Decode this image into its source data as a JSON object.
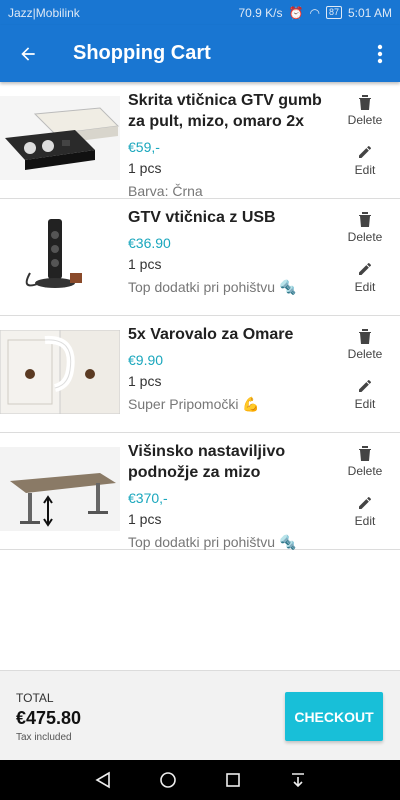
{
  "status": {
    "carrier": "Jazz|Mobilink",
    "speed": "70.9 K/s",
    "battery": "87",
    "time": "5:01 AM"
  },
  "appbar": {
    "title": "Shopping Cart"
  },
  "items": [
    {
      "name": "Skrita vtičnica GTV  gumb za pult, mizo, omaro 2x",
      "price": "€59,-",
      "qty": "1 pcs",
      "variant": "Barva: Črna",
      "delete_label": "Delete",
      "edit_label": "Edit"
    },
    {
      "name": "GTV vtičnica z USB",
      "price": "€36.90",
      "qty": "1 pcs",
      "variant": "Top dodatki pri pohištvu 🔩",
      "delete_label": "Delete",
      "edit_label": "Edit"
    },
    {
      "name": "5x Varovalo za Omare",
      "price": "€9.90",
      "qty": "1 pcs",
      "variant": "Super Pripomočki 💪",
      "delete_label": "Delete",
      "edit_label": "Edit"
    },
    {
      "name": "Višinsko nastaviljivo podnožje za mizo",
      "price": "€370,-",
      "qty": "1 pcs",
      "variant": "Top dodatki pri pohištvu 🔩",
      "delete_label": "Delete",
      "edit_label": "Edit"
    }
  ],
  "footer": {
    "total_label": "TOTAL",
    "total_value": "€475.80",
    "tax_note": "Tax included",
    "checkout_label": "CHECKOUT"
  },
  "colors": {
    "primary": "#1976d2",
    "accent": "#18bfd8",
    "price": "#1aa7bd"
  }
}
